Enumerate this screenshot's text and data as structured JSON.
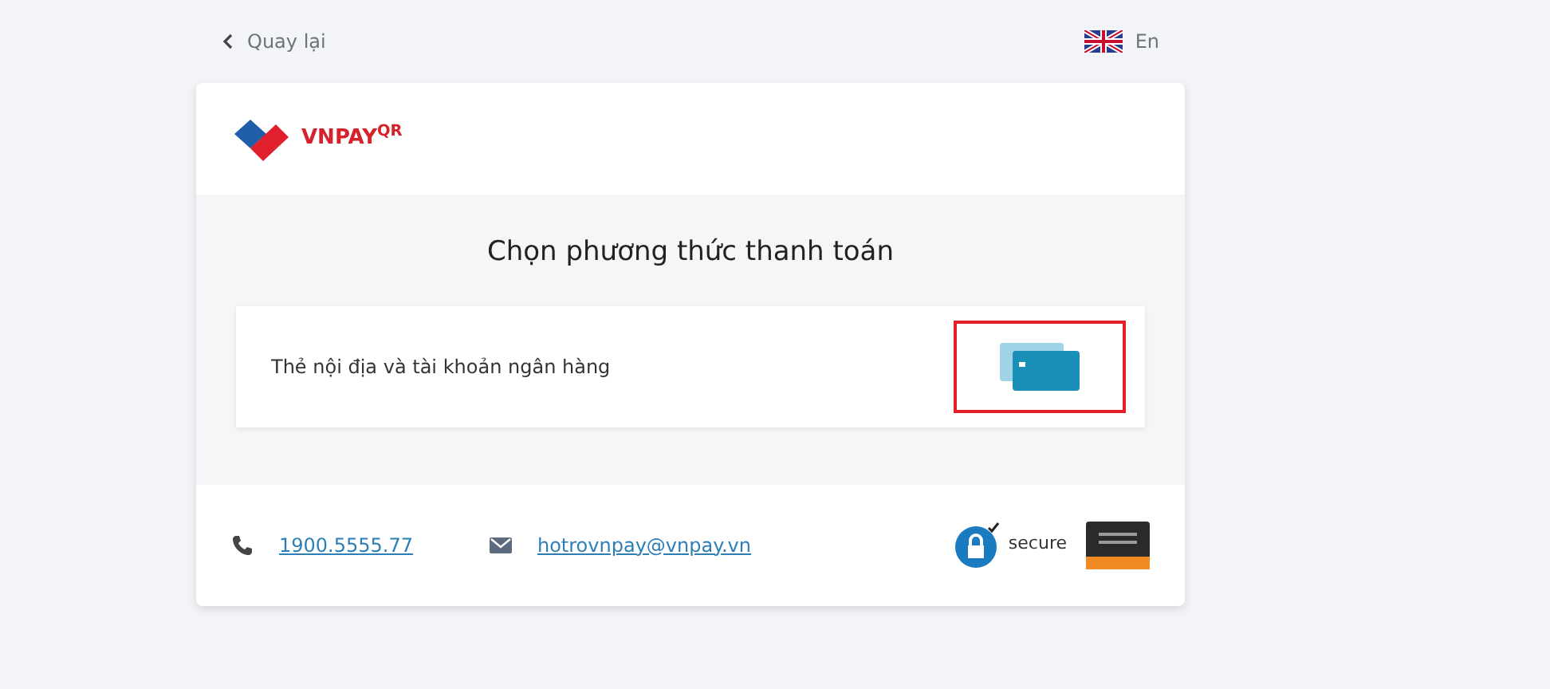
{
  "top_bar": {
    "back_label": "Quay lại",
    "language": "En"
  },
  "logo": {
    "text": "VNPAY",
    "superscript": "QR"
  },
  "heading": "Chọn phương thức thanh toán",
  "methods": [
    {
      "label": "Thẻ nội địa và tài khoản ngân hàng",
      "highlighted": true
    }
  ],
  "footer": {
    "phone": "1900.5555.77",
    "email": "hotrovnpay@vnpay.vn",
    "secure_badge": "secure"
  }
}
